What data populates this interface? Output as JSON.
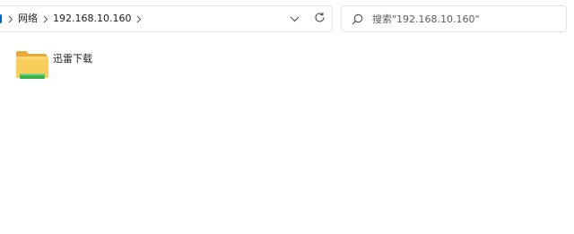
{
  "breadcrumb": {
    "items": [
      {
        "label": "网络"
      },
      {
        "label": "192.168.10.160"
      }
    ]
  },
  "search": {
    "placeholder": "搜索\"192.168.10.160\""
  },
  "files": [
    {
      "name": "迅雷下载",
      "icon": "folder-icon"
    }
  ],
  "colors": {
    "accent": "#0067c0",
    "folder_yellow": "#f6c84c",
    "folder_green": "#3cb44b"
  }
}
